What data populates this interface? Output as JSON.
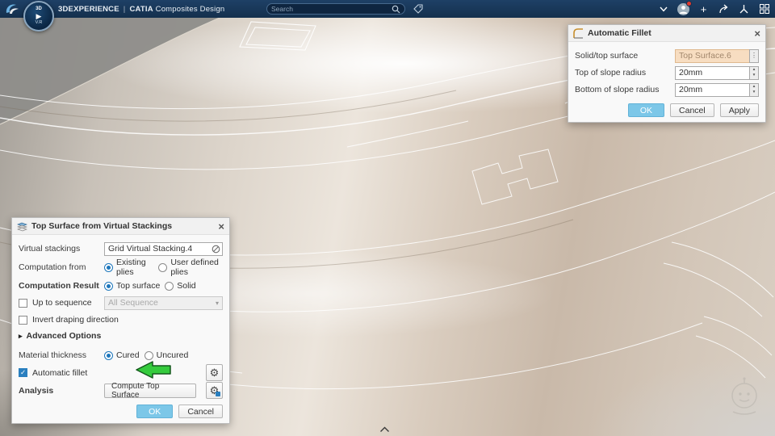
{
  "header": {
    "brand": "3DEXPERIENCE",
    "divider": "|",
    "app": "CATIA",
    "app_suffix": "Composites Design",
    "search_placeholder": "Search"
  },
  "compass": {
    "top_label": "3D",
    "bottom_label": "V.R"
  },
  "icons": {
    "close": "×",
    "dots": "⋮",
    "spin_up": "▴",
    "spin_down": "▾",
    "dropdown": "▾",
    "collapsed_arrow": "▸",
    "gear": "⚙",
    "check": "✓",
    "plus": "+",
    "play": "▶"
  },
  "fillet_dialog": {
    "title": "Automatic Fillet",
    "rows": [
      {
        "label": "Solid/top surface",
        "value": "Top Surface.6"
      },
      {
        "label": "Top of slope radius",
        "value": "20mm"
      },
      {
        "label": "Bottom of slope radius",
        "value": "20mm"
      }
    ],
    "ok": "OK",
    "cancel": "Cancel",
    "apply": "Apply"
  },
  "stacking_dialog": {
    "title": "Top Surface from Virtual Stackings",
    "virtual_stackings": {
      "label": "Virtual stackings",
      "value": "Grid Virtual Stacking.4"
    },
    "computation_from": {
      "label": "Computation from",
      "options": [
        "Existing plies",
        "User defined plies"
      ]
    },
    "computation_result": {
      "label": "Computation Result",
      "options": [
        "Top surface",
        "Solid"
      ]
    },
    "up_to_sequence": {
      "label": "Up to sequence",
      "value": "All Sequence"
    },
    "invert": {
      "label": "Invert draping direction"
    },
    "advanced": {
      "label": "Advanced Options"
    },
    "material": {
      "label": "Material thickness",
      "options": [
        "Cured",
        "Uncured"
      ]
    },
    "auto_fillet": {
      "label": "Automatic fillet"
    },
    "analysis": {
      "label": "Analysis",
      "button": "Compute Top Surface"
    },
    "ok": "OK",
    "cancel": "Cancel"
  }
}
